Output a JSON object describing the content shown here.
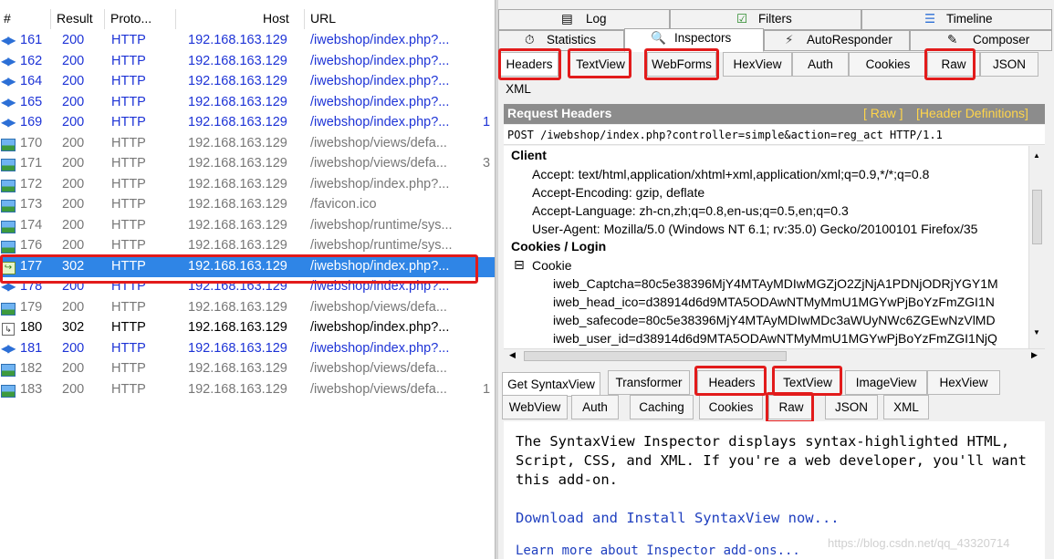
{
  "sessions": {
    "columns": [
      "#",
      "Result",
      "Proto...",
      "Host",
      "URL"
    ],
    "rows": [
      {
        "num": "161",
        "result": "200",
        "proto": "HTTP",
        "host": "192.168.163.129",
        "url": "/iwebshop/index.php?...",
        "extra": "",
        "icon": "arrows-icon",
        "style": "blue"
      },
      {
        "num": "162",
        "result": "200",
        "proto": "HTTP",
        "host": "192.168.163.129",
        "url": "/iwebshop/index.php?...",
        "extra": "",
        "icon": "arrows-icon",
        "style": "blue"
      },
      {
        "num": "164",
        "result": "200",
        "proto": "HTTP",
        "host": "192.168.163.129",
        "url": "/iwebshop/index.php?...",
        "extra": "",
        "icon": "arrows-icon",
        "style": "blue"
      },
      {
        "num": "165",
        "result": "200",
        "proto": "HTTP",
        "host": "192.168.163.129",
        "url": "/iwebshop/index.php?...",
        "extra": "",
        "icon": "arrows-icon",
        "style": "blue"
      },
      {
        "num": "169",
        "result": "200",
        "proto": "HTTP",
        "host": "192.168.163.129",
        "url": "/iwebshop/index.php?...",
        "extra": "1",
        "icon": "arrows-icon",
        "style": "blue"
      },
      {
        "num": "170",
        "result": "200",
        "proto": "HTTP",
        "host": "192.168.163.129",
        "url": "/iwebshop/views/defa...",
        "extra": "",
        "icon": "image-icon",
        "style": "grey"
      },
      {
        "num": "171",
        "result": "200",
        "proto": "HTTP",
        "host": "192.168.163.129",
        "url": "/iwebshop/views/defa...",
        "extra": "3",
        "icon": "image-icon",
        "style": "grey"
      },
      {
        "num": "172",
        "result": "200",
        "proto": "HTTP",
        "host": "192.168.163.129",
        "url": "/iwebshop/index.php?...",
        "extra": "",
        "icon": "image-icon",
        "style": "grey"
      },
      {
        "num": "173",
        "result": "200",
        "proto": "HTTP",
        "host": "192.168.163.129",
        "url": "/favicon.ico",
        "extra": "",
        "icon": "image-icon",
        "style": "grey"
      },
      {
        "num": "174",
        "result": "200",
        "proto": "HTTP",
        "host": "192.168.163.129",
        "url": "/iwebshop/runtime/sys...",
        "extra": "",
        "icon": "image-icon",
        "style": "grey"
      },
      {
        "num": "176",
        "result": "200",
        "proto": "HTTP",
        "host": "192.168.163.129",
        "url": "/iwebshop/runtime/sys...",
        "extra": "",
        "icon": "image-icon",
        "style": "grey"
      },
      {
        "num": "177",
        "result": "302",
        "proto": "HTTP",
        "host": "192.168.163.129",
        "url": "/iwebshop/index.php?...",
        "extra": "",
        "icon": "redirect-icon",
        "style": "sel"
      },
      {
        "num": "178",
        "result": "200",
        "proto": "HTTP",
        "host": "192.168.163.129",
        "url": "/iwebshop/index.php?...",
        "extra": "",
        "icon": "arrows-icon",
        "style": "blue"
      },
      {
        "num": "179",
        "result": "200",
        "proto": "HTTP",
        "host": "192.168.163.129",
        "url": "/iwebshop/views/defa...",
        "extra": "",
        "icon": "image-icon",
        "style": "grey"
      },
      {
        "num": "180",
        "result": "302",
        "proto": "HTTP",
        "host": "192.168.163.129",
        "url": "/iwebshop/index.php?...",
        "extra": "",
        "icon": "document-icon",
        "style": "black"
      },
      {
        "num": "181",
        "result": "200",
        "proto": "HTTP",
        "host": "192.168.163.129",
        "url": "/iwebshop/index.php?...",
        "extra": "",
        "icon": "arrows-icon",
        "style": "blue"
      },
      {
        "num": "182",
        "result": "200",
        "proto": "HTTP",
        "host": "192.168.163.129",
        "url": "/iwebshop/views/defa...",
        "extra": "",
        "icon": "image-icon",
        "style": "grey"
      },
      {
        "num": "183",
        "result": "200",
        "proto": "HTTP",
        "host": "192.168.163.129",
        "url": "/iwebshop/views/defa...",
        "extra": "1",
        "icon": "image-icon",
        "style": "grey"
      }
    ]
  },
  "top_tabs": {
    "log": "Log",
    "filters": "Filters",
    "timeline": "Timeline",
    "statistics": "Statistics",
    "inspectors": "Inspectors",
    "autoresponder": "AutoResponder",
    "composer": "Composer"
  },
  "request_tabs": [
    "Headers",
    "TextView",
    "WebForms",
    "HexView",
    "Auth",
    "Cookies",
    "Raw",
    "JSON",
    "XML"
  ],
  "request_headers": {
    "title": "Request Headers",
    "raw_link": "[ Raw ]",
    "defs_link": "[Header Definitions]",
    "request_line": "POST /iwebshop/index.php?controller=simple&action=reg_act HTTP/1.1",
    "client_group": "Client",
    "client_lines": [
      "Accept: text/html,application/xhtml+xml,application/xml;q=0.9,*/*;q=0.8",
      "Accept-Encoding: gzip, deflate",
      "Accept-Language: zh-cn,zh;q=0.8,en-us;q=0.5,en;q=0.3",
      "User-Agent: Mozilla/5.0 (Windows NT 6.1; rv:35.0) Gecko/20100101 Firefox/35"
    ],
    "cookies_group": "Cookies / Login",
    "cookie_node": "Cookie",
    "cookie_lines": [
      "iweb_Captcha=80c5e38396MjY4MTAyMDIwMGZjO2ZjNjA1PDNjODRjYGY1M",
      "iweb_head_ico=d38914d6d9MTA5ODAwNTMyMmU1MGYwPjBoYzFmZGI1N",
      "iweb_safecode=80c5e38396MjY4MTAyMDIwMDc3aWUyNWc6ZGEwNzVlMD",
      "iweb_user_id=d38914d6d9MTA5ODAwNTMyMmU1MGYwPjBoYzFmZGI1NjQ"
    ]
  },
  "response_tabs_row1": [
    "Get SyntaxView",
    "Transformer",
    "Headers",
    "TextView",
    "ImageView",
    "HexView"
  ],
  "response_tabs_row2": [
    "WebView",
    "Auth",
    "Caching",
    "Cookies",
    "Raw",
    "JSON",
    "XML"
  ],
  "syntaxview": {
    "line1": "The SyntaxView Inspector displays syntax-highlighted HTML,",
    "line2": "Script, CSS, and XML. If you're a web developer, you'll want",
    "line3": "this add-on.",
    "download_link": "Download and Install SyntaxView now...",
    "learn_link": "Learn more about Inspector add-ons...",
    "watermark": "https://blog.csdn.net/qq_43320714"
  },
  "colors": {
    "session_blue": "#1d33d6",
    "selection": "#2f85e6",
    "highlight_box": "#e21b1b",
    "header_bar": "#8c8c8c",
    "header_link": "#ffd54a"
  }
}
